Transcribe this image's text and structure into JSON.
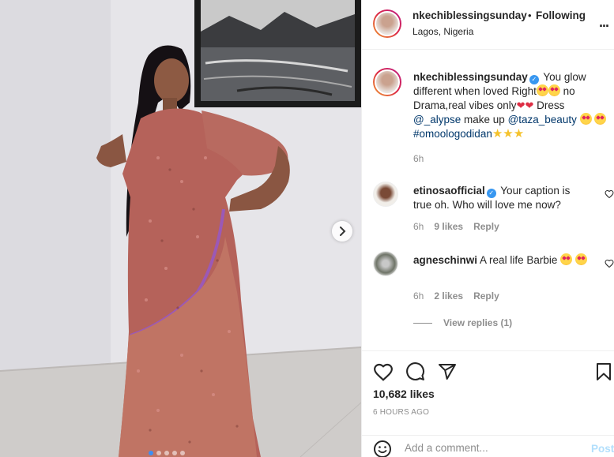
{
  "post": {
    "username": "nkechiblessingsunday",
    "follow_separator": "•",
    "follow_label": "Following",
    "location": "Lagos, Nigeria",
    "more_label": "...",
    "caption": {
      "username": "nkechiblessingsunday",
      "text_1": "You glow different when loved Right",
      "text_2": "no Drama,real vibes only",
      "text_3": "Dress",
      "mention_dress": "@_alypse",
      "text_4": "make up",
      "mention_makeup": "@taza_beauty",
      "hashtag": "#omoologodidan",
      "time": "6h"
    },
    "comments": [
      {
        "username": "etinosaofficial",
        "verified": true,
        "text": "Your caption is true oh. Who will love me now?",
        "time": "6h",
        "likes": "9 likes",
        "reply_label": "Reply"
      },
      {
        "username": "agneschinwi",
        "verified": false,
        "text": "A real life Barbie",
        "time": "6h",
        "likes": "2 likes",
        "reply_label": "Reply"
      }
    ],
    "view_replies": "View replies (1)",
    "likes_count": "10,682 likes",
    "time_ago": "6 HOURS AGO",
    "comment_placeholder": "Add a comment...",
    "post_button": "Post",
    "carousel": {
      "slides": 5,
      "active_index": 0
    }
  },
  "colors": {
    "link": "#00376b",
    "verified": "#3897f0",
    "muted": "#8e8e8e",
    "post_button_disabled": "#b2dffc",
    "carousel_active": "#3b8ff5"
  },
  "icons": [
    "verified-icon",
    "heart-icon",
    "comment-icon",
    "share-icon",
    "bookmark-icon",
    "emoji-icon",
    "chevron-right-icon",
    "more-icon"
  ]
}
